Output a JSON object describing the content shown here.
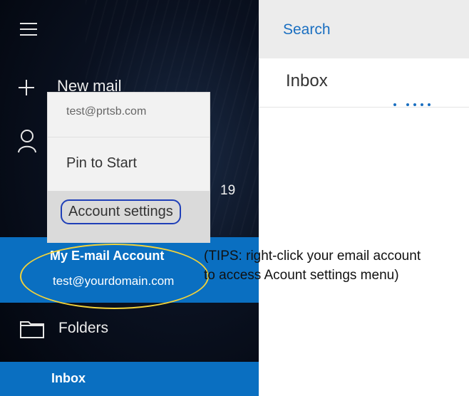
{
  "sidebar": {
    "new_mail_label": "New mail",
    "account_count": "19",
    "account": {
      "name": "My E-mail Account",
      "email": "test@yourdomain.com"
    },
    "folders_label": "Folders",
    "inbox_label": "Inbox"
  },
  "context_menu": {
    "header_email": "test@prtsb.com",
    "items": [
      "Pin to Start",
      "Account settings"
    ]
  },
  "main": {
    "search_label": "Search",
    "inbox_title": "Inbox"
  },
  "annotation": {
    "tips_line1": "(TIPS: right-click your email account",
    "tips_line2": "to access Acount settings menu)"
  },
  "icons": {
    "menu": "hamburger-icon",
    "new_mail": "plus-icon",
    "accounts": "person-icon",
    "folders": "folder-icon"
  },
  "colors": {
    "accent": "#0a6fc1",
    "highlight_oval": "#f2d23a",
    "highlight_box": "#1f3fb8"
  }
}
